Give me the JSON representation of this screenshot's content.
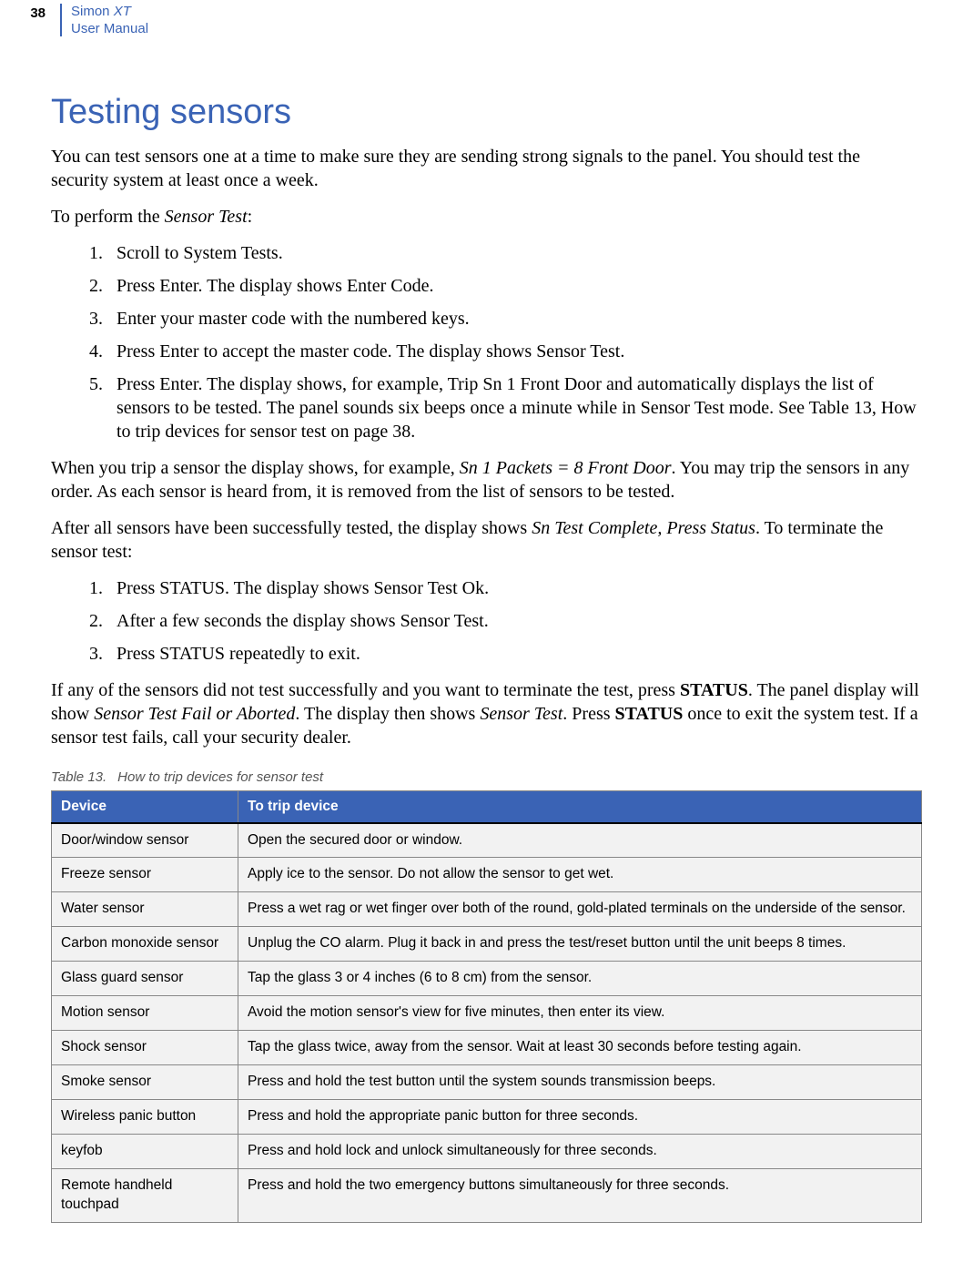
{
  "header": {
    "page_number": "38",
    "product_line1_a": "Simon ",
    "product_line1_b": "XT",
    "product_line2": "User Manual"
  },
  "section_title": "Testing sensors",
  "intro": {
    "pre": "You can test sensors one at a time to make sure they are sending strong signals to the panel. You should test the security system at least once a week."
  },
  "perform_label_pre": "To perform the ",
  "perform_label_ital": "Sensor Test",
  "perform_label_post": ":",
  "steps1": {
    "s1_pre": "Scroll to ",
    "s1_ital": "System Tests",
    "s1_post": ".",
    "s2_pre": "Press ",
    "s2_bold": "Enter",
    "s2_mid": ". The display shows ",
    "s2_ital": "Enter Code",
    "s2_post": ".",
    "s3": "Enter your master code with the numbered keys.",
    "s4_pre": "Press ",
    "s4_bold": "Enter",
    "s4_mid": " to accept the master code. The display shows ",
    "s4_ital": "Sensor Test",
    "s4_post": ".",
    "s5_pre": "Press ",
    "s5_bold": "Enter",
    "s5_a": ". The display shows, for example, ",
    "s5_ital1": "Trip Sn 1 Front Door",
    "s5_b": " and automatically displays the list of sensors to be tested. The panel sounds six beeps once a minute while in ",
    "s5_ital2": "Sensor Test",
    "s5_c": " mode. See ",
    "s5_ital3": "Table 13, ",
    "s5_link": "How to trip devices for sensor test",
    "s5_d": " on page 38."
  },
  "mid1_pre": "When you trip a sensor the display shows, for example, ",
  "mid1_ital": "Sn 1 Packets = 8 Front Door",
  "mid1_post": ". You may trip the sensors in any order. As each sensor is heard from, it is removed from the list of sensors to be tested.",
  "mid2_pre": "After all sensors have been successfully tested, the display shows ",
  "mid2_ital": "Sn Test Complete, Press Status",
  "mid2_post": ". To terminate the sensor test:",
  "steps2": {
    "s1_pre": "Press ",
    "s1_bold": "STATUS",
    "s1_mid": ". The display shows ",
    "s1_ital": "Sensor Test Ok",
    "s1_post": ".",
    "s2_pre": "After a few seconds the display shows ",
    "s2_ital": "Sensor Test",
    "s2_post": ".",
    "s3_pre": "Press ",
    "s3_bold": "STATUS",
    "s3_post": " repeatedly to exit."
  },
  "closing_a": "If any of the sensors did not test successfully and you want to terminate the test, press ",
  "closing_bold1": "STATUS",
  "closing_b": ". The panel display will show ",
  "closing_ital1": "Sensor Test Fail or Aborted",
  "closing_c": ". The display then shows ",
  "closing_ital2": "Sensor Test",
  "closing_d": ". Press ",
  "closing_bold2": "STATUS",
  "closing_e": " once to exit the system test. If a sensor test fails, call your security dealer.",
  "table": {
    "caption_num": "Table 13.",
    "caption_title": "How to trip devices for sensor test",
    "head_device": "Device",
    "head_action": "To trip device",
    "rows": [
      {
        "device": "Door/window sensor",
        "action": "Open the secured door or window."
      },
      {
        "device": "Freeze sensor",
        "action": "Apply ice to the sensor. Do not allow the sensor to get wet."
      },
      {
        "device": "Water sensor",
        "action": "Press a wet rag or wet finger over both of the round, gold-plated terminals on the underside of the sensor."
      },
      {
        "device": "Carbon monoxide sensor",
        "action": "Unplug the CO alarm. Plug it back in and press the test/reset button until the unit beeps 8 times."
      },
      {
        "device": "Glass guard sensor",
        "action": "Tap the glass 3 or 4 inches (6 to 8 cm) from the sensor."
      },
      {
        "device": "Motion sensor",
        "action": "Avoid the motion sensor's view for five minutes, then enter its view."
      },
      {
        "device": "Shock sensor",
        "action": "Tap the glass twice, away from the sensor. Wait at least 30 seconds before testing again."
      },
      {
        "device": "Smoke sensor",
        "action": "Press and hold the test button until the system sounds transmission beeps."
      },
      {
        "device": "Wireless panic button",
        "action": "Press and hold the appropriate panic button for three seconds."
      },
      {
        "device": "keyfob",
        "action": "Press and hold lock and unlock simultaneously for three seconds."
      },
      {
        "device": "Remote handheld touchpad",
        "action": "Press and hold the two emergency buttons simultaneously for three seconds."
      }
    ]
  }
}
